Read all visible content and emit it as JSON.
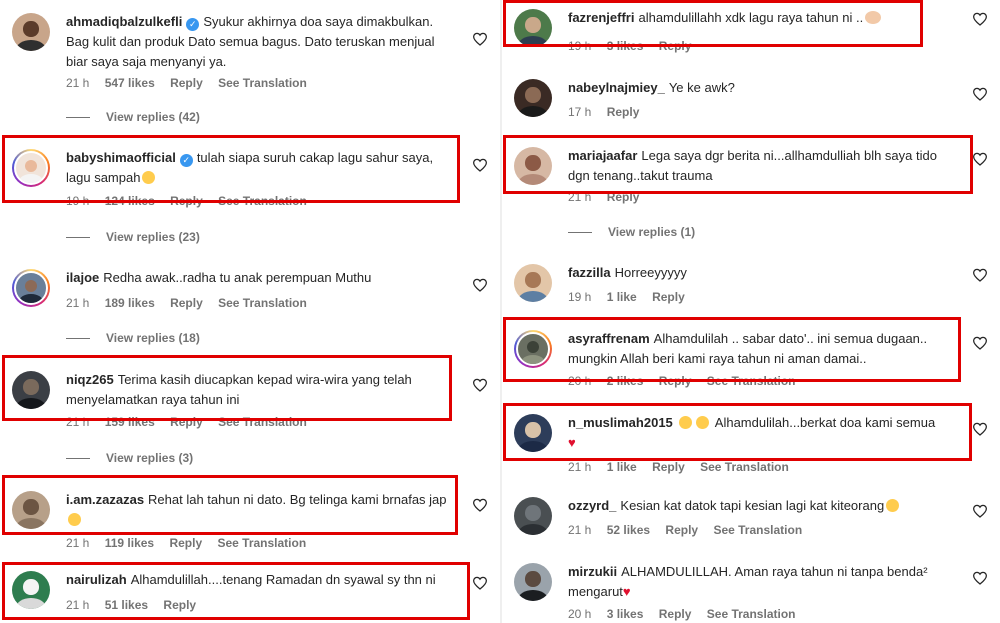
{
  "left_comments": [
    {
      "username": "ahmadiqbalzulkefli",
      "verified": true,
      "text": "Syukur akhirnya doa saya dimakbulkan. Bag kulit dan produk Dato semua bagus. Dato teruskan menjual biar saya saja menyanyi ya.",
      "time": "21 h",
      "likes": "547 likes",
      "reply": "Reply",
      "translate": "See Translation",
      "view_replies": "View replies (42)"
    },
    {
      "username": "babyshimaofficial",
      "verified": true,
      "text": "tulah siapa suruh cakap lagu sahur saya, lagu sampah",
      "time": "19 h",
      "likes": "124 likes",
      "reply": "Reply",
      "translate": "See Translation",
      "view_replies": "View replies (23)"
    },
    {
      "username": "ilajoe",
      "verified": false,
      "text": "Redha awak..radha tu anak perempuan Muthu",
      "time": "21 h",
      "likes": "189 likes",
      "reply": "Reply",
      "translate": "See Translation",
      "view_replies": "View replies (18)"
    },
    {
      "username": "niqz265",
      "verified": false,
      "text": "Terima kasih diucapkan kepad wira-wira yang telah menyelamatkan raya tahun ini",
      "time": "21 h",
      "likes": "159 likes",
      "reply": "Reply",
      "translate": "See Translation",
      "view_replies": "View replies (3)"
    },
    {
      "username": "i.am.zazazas",
      "verified": false,
      "text": "Rehat lah tahun ni dato. Bg telinga kami brnafas jap",
      "time": "21 h",
      "likes": "119 likes",
      "reply": "Reply",
      "translate": "See Translation"
    },
    {
      "username": "nairulizah",
      "verified": false,
      "text": "Alhamdulillah....tenang Ramadan dn syawal sy thn ni",
      "time": "21 h",
      "likes": "51 likes",
      "reply": "Reply"
    }
  ],
  "right_comments": [
    {
      "username": "fazrenjeffri",
      "text": "alhamdulillahh xdk lagu raya tahun ni ..",
      "time": "19 h",
      "likes": "3 likes",
      "reply": "Reply"
    },
    {
      "username": "nabeylnajmiey_",
      "text": "Ye ke awk?",
      "time": "17 h",
      "reply": "Reply"
    },
    {
      "username": "mariajaafar",
      "text": "Lega saya dgr berita ni...allhamdulliah blh saya tido dgn tenang..takut trauma",
      "time": "21 h",
      "reply": "Reply",
      "view_replies": "View replies (1)"
    },
    {
      "username": "fazzilla",
      "text": "Horreeyyyyy",
      "time": "19 h",
      "likes": "1 like",
      "reply": "Reply"
    },
    {
      "username": "asyraffrenam",
      "text": "Alhamdulilah .. sabar dato'.. ini semua dugaan.. mungkin Allah beri kami raya tahun ni aman damai..",
      "time": "20 h",
      "likes": "2 likes",
      "reply": "Reply",
      "translate": "See Translation"
    },
    {
      "username": "n_muslimah2015",
      "text": "Alhamdulilah...berkat doa kami semua",
      "time": "21 h",
      "likes": "1 like",
      "reply": "Reply",
      "translate": "See Translation"
    },
    {
      "username": "ozzyrd_",
      "text": "Kesian kat datok tapi kesian lagi kat kiteorang",
      "time": "21 h",
      "likes": "52 likes",
      "reply": "Reply",
      "translate": "See Translation"
    },
    {
      "username": "mirzukii",
      "text": "ALHAMDULILLAH. Aman raya tahun ni tanpa benda² mengarut",
      "time": "20 h",
      "likes": "3 likes",
      "reply": "Reply",
      "translate": "See Translation"
    }
  ],
  "colors": {
    "highlight": "#e00000",
    "verified": "#3897f0",
    "meta_text": "#737373"
  },
  "icons": {
    "like": "heart-outline-icon",
    "verified": "verified-badge-icon"
  }
}
